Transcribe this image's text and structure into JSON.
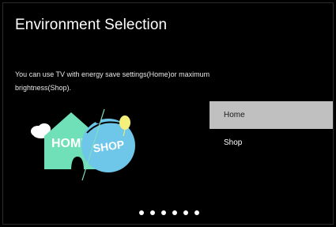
{
  "screen": {
    "title": "Environment Selection",
    "description": "You can use TV with energy save settings(Home)or maximum brightness(Shop)."
  },
  "illustration": {
    "home_label": "HOME",
    "shop_label": "SHOP",
    "colors": {
      "home": "#6fe0b8",
      "shop": "#6ec6e8",
      "balloon": "#f4f07a",
      "line": "#7fe0c0"
    }
  },
  "menu": {
    "items": [
      {
        "label": "Home",
        "selected": true
      },
      {
        "label": "Shop",
        "selected": false
      }
    ],
    "selected_color": "#c0c0c0"
  },
  "pagination": {
    "count": 6,
    "icon": "page-dot-icon"
  }
}
